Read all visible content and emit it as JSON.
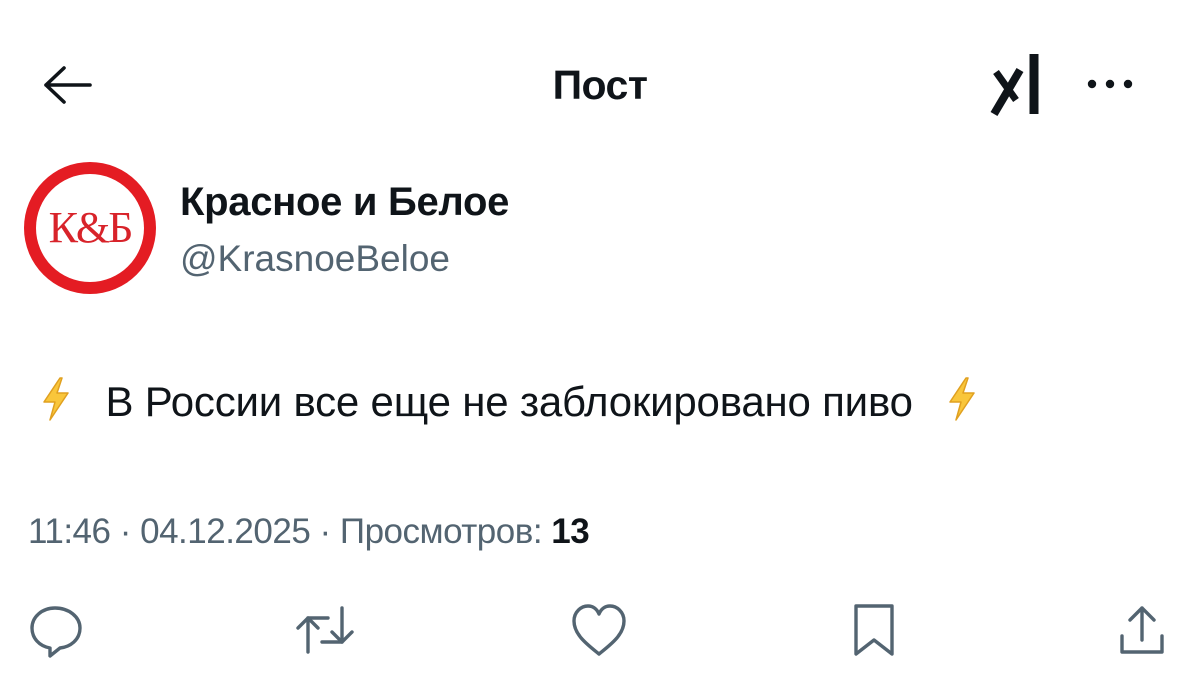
{
  "header": {
    "title": "Пост",
    "back_icon": "arrow-left-icon",
    "grok_icon": "grok-icon",
    "more_icon": "more-horizontal-icon"
  },
  "author": {
    "display_name": "Красное и Белое",
    "handle": "@KrasnoeBeloe",
    "avatar_text": "К&Б",
    "avatar_color": "#e41c23"
  },
  "post": {
    "emoji_icon": "lightning-bolt-icon",
    "text": "В России все еще не заблокировано пиво"
  },
  "meta": {
    "time": "11:46",
    "separator": "·",
    "date": "04.12.2025",
    "views_label": "Просмотров:",
    "views_count": "13"
  },
  "actions": [
    {
      "name": "reply",
      "icon": "reply-icon"
    },
    {
      "name": "repost",
      "icon": "repost-icon"
    },
    {
      "name": "like",
      "icon": "heart-icon"
    },
    {
      "name": "bookmark",
      "icon": "bookmark-icon"
    },
    {
      "name": "share",
      "icon": "share-icon"
    }
  ],
  "colors": {
    "text_primary": "#0f1419",
    "text_secondary": "#536471",
    "icon": "#536471",
    "bolt_fill": "#f9c63b",
    "bolt_stroke": "#e0a020"
  }
}
